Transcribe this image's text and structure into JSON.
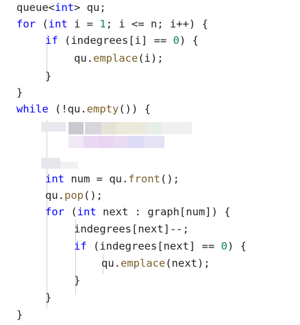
{
  "code": {
    "l1": {
      "a": "queue<",
      "t": "int",
      "b": "> qu;"
    },
    "l2": {
      "kw": "for",
      "a": " (",
      "t": "int",
      "b": " i = ",
      "n": "1",
      "c": "; i <= n; i++) {"
    },
    "l3": {
      "kw": "if",
      "a": " (indegrees[i] == ",
      "n": "0",
      "b": ") {"
    },
    "l4": {
      "a": "qu.",
      "fn": "emplace",
      "b": "(i);"
    },
    "l5": {
      "a": "}"
    },
    "l6": {
      "a": "}"
    },
    "l7": {
      "kw": "while",
      "a": " (!qu.",
      "fn": "empty",
      "b": "()) {"
    },
    "l11": {
      "t": "int",
      "a": " num = qu.",
      "fn": "front",
      "b": "();"
    },
    "l12": {
      "a": "qu.",
      "fn": "pop",
      "b": "();"
    },
    "l13": {
      "kw": "for",
      "a": " (",
      "t": "int",
      "b": " next : graph[num]) {"
    },
    "l14": {
      "a": "indegrees[next]--;"
    },
    "l15": {
      "kw": "if",
      "a": " (indegrees[next] == ",
      "n": "0",
      "b": ") {"
    },
    "l16": {
      "a": "qu.",
      "fn": "emplace",
      "b": "(next);"
    },
    "l17": {
      "a": "}"
    },
    "l18": {
      "a": "}"
    },
    "l19": {
      "a": "}"
    }
  },
  "colors": {
    "keyword": "#0000ff",
    "function": "#795e26",
    "number": "#098658",
    "text": "#1f1f1f",
    "background": "#ffffff"
  }
}
